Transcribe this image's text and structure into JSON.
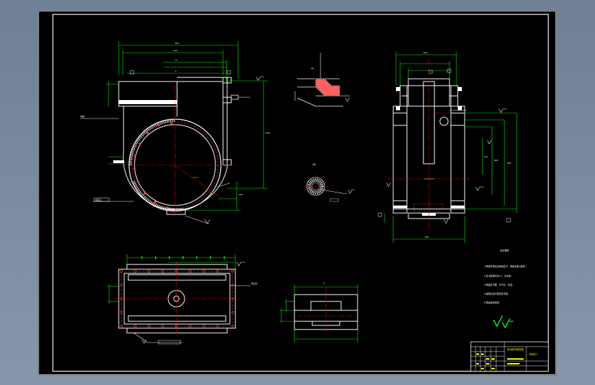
{
  "drawing": {
    "tech_requirements_title": "技术要求",
    "tech_notes": [
      "1.焊接件焊后应消除应力，焊缝高度≥板厚…",
      "2.未注倒角均为C1，去毛刺。",
      "3.焊缝应平整，无气孔、夹渣。",
      "4.装配后进行密封性试验。",
      "5.表面涂防锈漆。"
    ],
    "part_callouts": [
      "喷嘴",
      "吸风口",
      "排尘管"
    ],
    "title_block": {
      "drawing_name": "除尘器壳体装配图",
      "company": "机械设计"
    },
    "colors": {
      "sheet": "#000000",
      "outline": "#ffffff",
      "dimension": "#00ff00",
      "centerline": "#ff0000",
      "hidden": "#ff4040",
      "highlight": "#ffff00"
    }
  }
}
